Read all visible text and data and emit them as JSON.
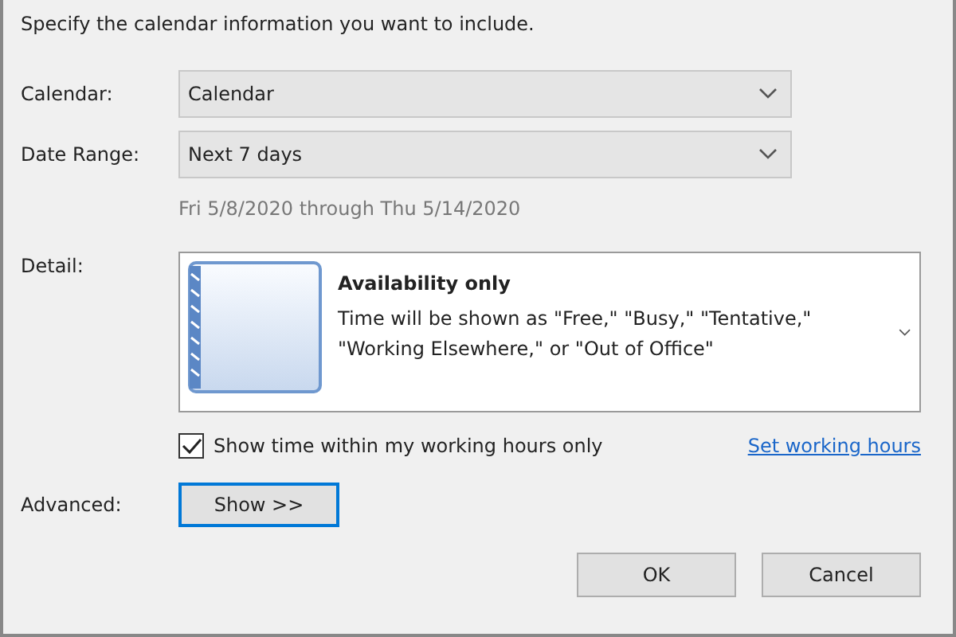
{
  "instruction": "Specify the calendar information you want to include.",
  "fields": [
    {
      "label": "Calendar:",
      "value": "Calendar"
    },
    {
      "label": "Date Range:",
      "value": "Next 7 days"
    }
  ],
  "date_range_text": "Fri 5/8/2020 through Thu 5/14/2020",
  "detail": {
    "label": "Detail:",
    "title": "Availability only",
    "description": "Time will be shown as \"Free,\" \"Busy,\" \"Tentative,\" \"Working Elsewhere,\" or \"Out of Office\""
  },
  "working_hours": {
    "label": "Show time within my working hours only",
    "checked": true,
    "link": "Set working hours"
  },
  "advanced": {
    "label": "Advanced:",
    "button": "Show >>"
  },
  "buttons": [
    "OK",
    "Cancel"
  ]
}
